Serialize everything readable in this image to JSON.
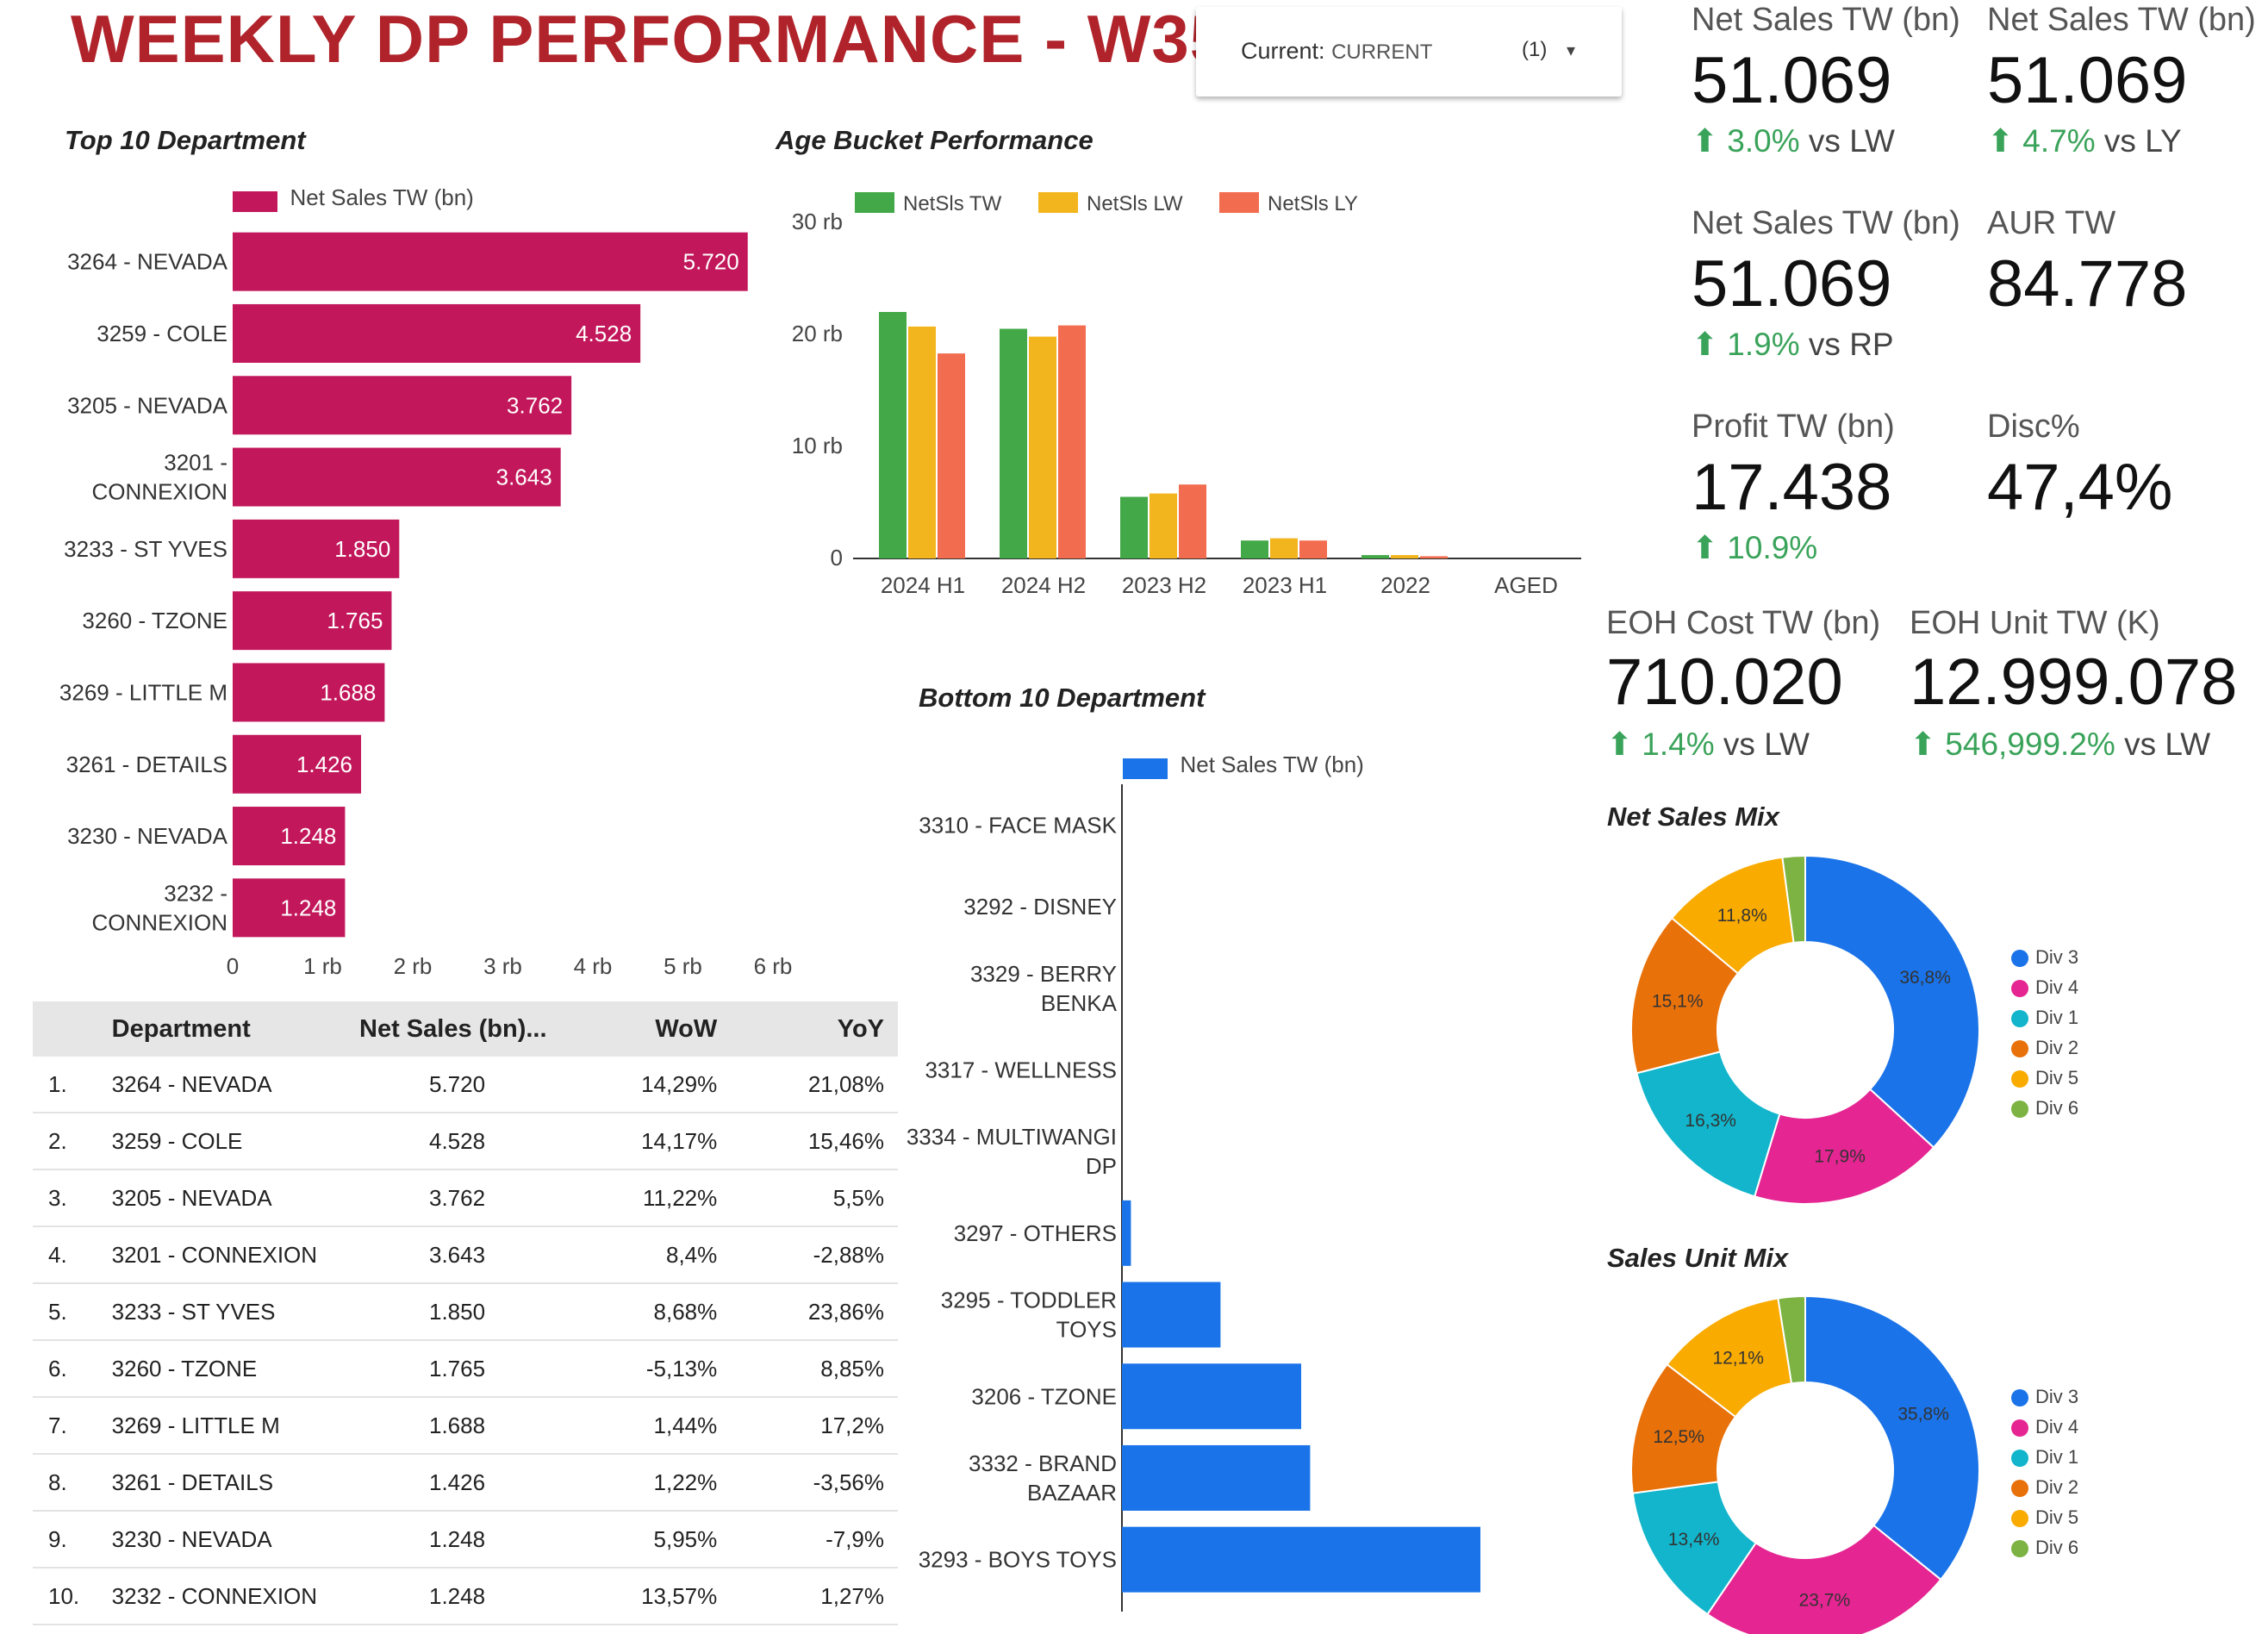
{
  "header": {
    "title": "WEEKLY DP PERFORMANCE - W35",
    "filter_label": "Current:",
    "filter_value": "CURRENT",
    "filter_count": "(1)"
  },
  "top10": {
    "title": "Top 10 Department",
    "legend": "Net Sales TW (bn)",
    "bar_color": "#c2185b",
    "label_color": "#ffffff"
  },
  "age": {
    "title": "Age Bucket Performance",
    "colors": [
      "#43a847",
      "#f3b51d",
      "#f26d4f"
    ]
  },
  "bottom10": {
    "title": "Bottom 10 Department",
    "legend": "Net Sales TW (bn)",
    "bar_color": "#1a73e8"
  },
  "kpis": {
    "k1": {
      "label": "Net Sales TW (bn)",
      "value": "51.069",
      "delta": "3.0%",
      "ref": "vs LW"
    },
    "k2": {
      "label": "Net Sales TW (bn)",
      "value": "51.069",
      "delta": "4.7%",
      "ref": "vs LY"
    },
    "k3": {
      "label": "Net Sales TW (bn)",
      "value": "51.069",
      "delta": "1.9%",
      "ref": "vs RP"
    },
    "k4": {
      "label": "AUR TW",
      "value": "84.778"
    },
    "k5": {
      "label": "Profit TW (bn)",
      "value": "17.438",
      "delta": "10.9%"
    },
    "k6": {
      "label": "Disc%",
      "value": "47,4%"
    },
    "k7": {
      "label": "EOH Cost TW (bn)",
      "value": "710.020",
      "delta": "1.4%",
      "ref": "vs LW"
    },
    "k8": {
      "label": "EOH Unit TW (K)",
      "value": "12.999.078",
      "delta": "546,999.2%",
      "ref": "vs LW"
    },
    "delta_color": "#3aa35a"
  },
  "mix": {
    "net_title": "Net Sales Mix",
    "unit_title": "Sales Unit Mix"
  },
  "table": {
    "headers": [
      "Department",
      "Net Sales (bn)...",
      "WoW",
      "YoY"
    ],
    "rows": [
      [
        "1.",
        "3264 - NEVADA",
        "5.720",
        "14,29%",
        "21,08%"
      ],
      [
        "2.",
        "3259 - COLE",
        "4.528",
        "14,17%",
        "15,46%"
      ],
      [
        "3.",
        "3205 - NEVADA",
        "3.762",
        "11,22%",
        "5,5%"
      ],
      [
        "4.",
        "3201 - CONNEXION",
        "3.643",
        "8,4%",
        "-2,88%"
      ],
      [
        "5.",
        "3233 - ST YVES",
        "1.850",
        "8,68%",
        "23,86%"
      ],
      [
        "6.",
        "3260 - TZONE",
        "1.765",
        "-5,13%",
        "8,85%"
      ],
      [
        "7.",
        "3269 - LITTLE M",
        "1.688",
        "1,44%",
        "17,2%"
      ],
      [
        "8.",
        "3261 - DETAILS",
        "1.426",
        "1,22%",
        "-3,56%"
      ],
      [
        "9.",
        "3230 - NEVADA",
        "1.248",
        "5,95%",
        "-7,9%"
      ],
      [
        "10.",
        "3232 - CONNEXION",
        "1.248",
        "13,57%",
        "1,27%"
      ]
    ]
  },
  "chart_data": [
    {
      "type": "bar",
      "orientation": "horizontal",
      "title": "Top 10 Department",
      "categories": [
        [
          "3264 - NEVADA"
        ],
        [
          "3259 - COLE"
        ],
        [
          "3205 - NEVADA"
        ],
        [
          "3201 -",
          "CONNEXION"
        ],
        [
          "3233 - ST YVES"
        ],
        [
          "3260 - TZONE"
        ],
        [
          "3269 - LITTLE M"
        ],
        [
          "3261 - DETAILS"
        ],
        [
          "3230 - NEVADA"
        ],
        [
          "3232 -",
          "CONNEXION"
        ]
      ],
      "series": [
        {
          "name": "Net Sales TW (bn)",
          "values": [
            5.72,
            4.528,
            3.762,
            3.643,
            1.85,
            1.765,
            1.688,
            1.426,
            1.248,
            1.248
          ]
        }
      ],
      "data_labels": [
        "5.720",
        "4.528",
        "3.762",
        "3.643",
        "1.850",
        "1.765",
        "1.688",
        "1.426",
        "1.248",
        "1.248"
      ],
      "xlim": [
        0,
        6
      ],
      "xticks": [
        "0",
        "1 rb",
        "2 rb",
        "3 rb",
        "4 rb",
        "5 rb",
        "6 rb"
      ]
    },
    {
      "type": "bar",
      "title": "Age Bucket Performance",
      "categories": [
        "2024 H1",
        "2024 H2",
        "2023 H2",
        "2023 H1",
        "2022",
        "AGED"
      ],
      "series": [
        {
          "name": "NetSls TW",
          "values": [
            22,
            20.5,
            5.5,
            1.6,
            0.3,
            0
          ]
        },
        {
          "name": "NetSls LW",
          "values": [
            20.7,
            19.8,
            5.8,
            1.8,
            0.3,
            0
          ]
        },
        {
          "name": "NetSls LY",
          "values": [
            18.3,
            20.8,
            6.6,
            1.6,
            0.2,
            0
          ]
        }
      ],
      "ylim": [
        0,
        30
      ],
      "yticks": [
        "0",
        "10 rb",
        "20 rb",
        "30 rb"
      ],
      "legend": "top"
    },
    {
      "type": "bar",
      "orientation": "horizontal",
      "title": "Bottom 10 Department",
      "categories": [
        [
          "3310 - FACE MASK"
        ],
        [
          "3292 - DISNEY"
        ],
        [
          "3329 - BERRY",
          "BENKA"
        ],
        [
          "3317 - WELLNESS"
        ],
        [
          "3334 - MULTIWANGI",
          "DP"
        ],
        [
          "3297 - OTHERS"
        ],
        [
          "3295 - TODDLER",
          "TOYS"
        ],
        [
          "3206 - TZONE"
        ],
        [
          "3332 - BRAND",
          "BAZAAR"
        ],
        [
          "3293 - BOYS TOYS"
        ]
      ],
      "series": [
        {
          "name": "Net Sales TW (bn)",
          "values": [
            0,
            0,
            0,
            0,
            0,
            0.002,
            0.022,
            0.04,
            0.042,
            0.08
          ]
        }
      ]
    },
    {
      "type": "pie",
      "title": "Net Sales Mix",
      "labels": [
        "Div 3",
        "Div 4",
        "Div 1",
        "Div 2",
        "Div 5",
        "Div 6"
      ],
      "values": [
        36.8,
        17.9,
        16.3,
        15.1,
        11.8,
        2.1
      ],
      "slice_labels": [
        "36,8%",
        "17,9%",
        "16,3%",
        "15,1%",
        "11,8%",
        ""
      ],
      "colors": [
        "#1a73e8",
        "#e52592",
        "#12b5cb",
        "#e8710a",
        "#f9ab00",
        "#7cb342"
      ],
      "legend": "right"
    },
    {
      "type": "pie",
      "title": "Sales Unit Mix",
      "labels": [
        "Div 3",
        "Div 4",
        "Div 1",
        "Div 2",
        "Div 5",
        "Div 6"
      ],
      "values": [
        35.8,
        23.7,
        13.4,
        12.5,
        12.1,
        2.5
      ],
      "slice_labels": [
        "35,8%",
        "23,7%",
        "13,4%",
        "12,5%",
        "12,1%",
        ""
      ],
      "colors": [
        "#1a73e8",
        "#e52592",
        "#12b5cb",
        "#e8710a",
        "#f9ab00",
        "#7cb342"
      ],
      "legend": "right"
    }
  ]
}
